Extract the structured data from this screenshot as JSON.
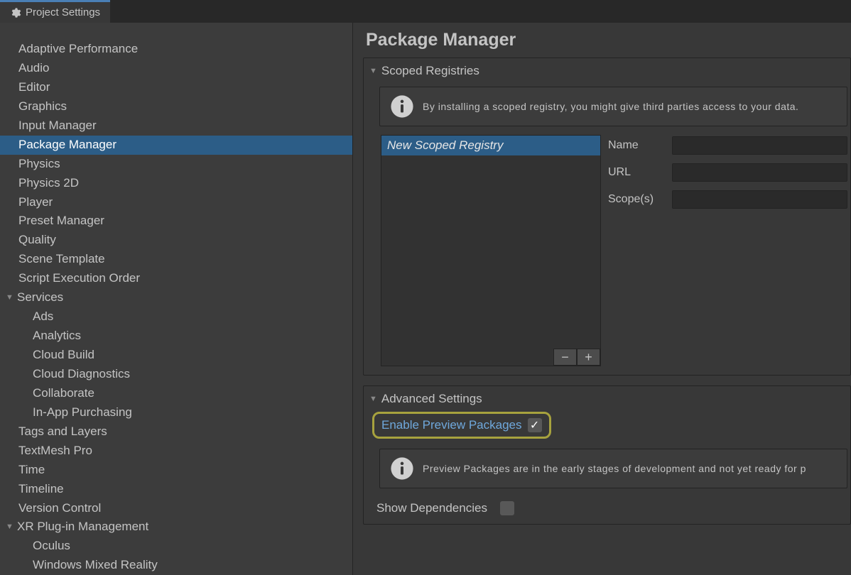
{
  "tab": {
    "title": "Project Settings"
  },
  "sidebar": {
    "items": [
      {
        "label": "Adaptive Performance",
        "key": "adaptive-performance"
      },
      {
        "label": "Audio",
        "key": "audio"
      },
      {
        "label": "Editor",
        "key": "editor"
      },
      {
        "label": "Graphics",
        "key": "graphics"
      },
      {
        "label": "Input Manager",
        "key": "input-manager"
      },
      {
        "label": "Package Manager",
        "key": "package-manager",
        "selected": true
      },
      {
        "label": "Physics",
        "key": "physics"
      },
      {
        "label": "Physics 2D",
        "key": "physics-2d"
      },
      {
        "label": "Player",
        "key": "player"
      },
      {
        "label": "Preset Manager",
        "key": "preset-manager"
      },
      {
        "label": "Quality",
        "key": "quality"
      },
      {
        "label": "Scene Template",
        "key": "scene-template"
      },
      {
        "label": "Script Execution Order",
        "key": "script-execution-order"
      }
    ],
    "services": {
      "label": "Services",
      "items": [
        {
          "label": "Ads",
          "key": "ads"
        },
        {
          "label": "Analytics",
          "key": "analytics"
        },
        {
          "label": "Cloud Build",
          "key": "cloud-build"
        },
        {
          "label": "Cloud Diagnostics",
          "key": "cloud-diagnostics"
        },
        {
          "label": "Collaborate",
          "key": "collaborate"
        },
        {
          "label": "In-App Purchasing",
          "key": "iap"
        }
      ]
    },
    "after_services": [
      {
        "label": "Tags and Layers",
        "key": "tags-layers"
      },
      {
        "label": "TextMesh Pro",
        "key": "tmp"
      },
      {
        "label": "Time",
        "key": "time"
      },
      {
        "label": "Timeline",
        "key": "timeline"
      },
      {
        "label": "Version Control",
        "key": "vcs"
      }
    ],
    "xr": {
      "label": "XR Plug-in Management",
      "items": [
        {
          "label": "Oculus",
          "key": "oculus"
        },
        {
          "label": "Windows Mixed Reality",
          "key": "wmr"
        }
      ]
    }
  },
  "page": {
    "title": "Package Manager"
  },
  "scoped_registries": {
    "header": "Scoped Registries",
    "warning": "By installing a scoped registry, you might give third parties access to your data.",
    "list": [
      {
        "label": "New Scoped Registry",
        "selected": true
      }
    ],
    "remove": "−",
    "add": "+",
    "form": {
      "name_label": "Name",
      "name_value": "",
      "url_label": "URL",
      "url_value": "",
      "scopes_label": "Scope(s)",
      "scopes_value": ""
    }
  },
  "advanced": {
    "header": "Advanced Settings",
    "enable_preview_label": "Enable Preview Packages",
    "enable_preview_checked": true,
    "preview_warning": "Preview Packages are in the early stages of development and not yet ready for p",
    "show_dependencies_label": "Show Dependencies",
    "show_dependencies_checked": false
  }
}
